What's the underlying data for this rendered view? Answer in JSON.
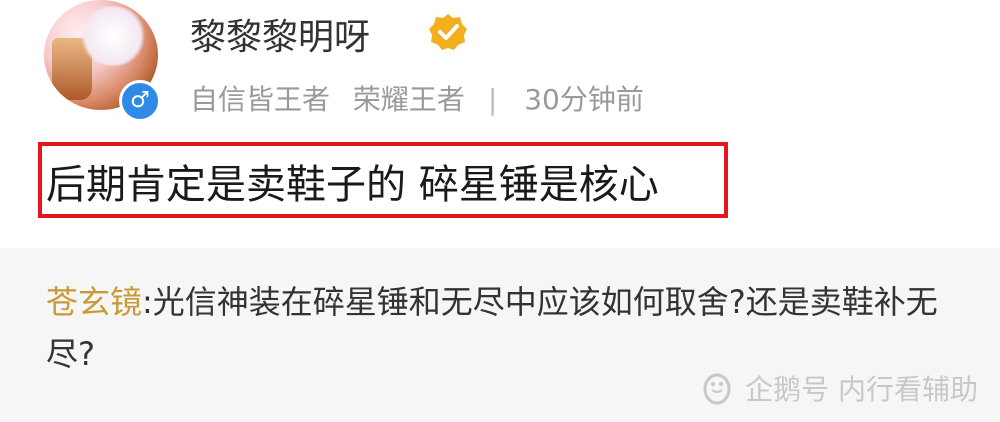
{
  "post": {
    "username": "黎黎黎明呀",
    "meta": {
      "title1": "自信皆王者",
      "title2": "荣耀王者",
      "separator": "|",
      "time": "30分钟前"
    },
    "gender_symbol": "♂",
    "comment": "后期肯定是卖鞋子的 碎星锤是核心"
  },
  "reply": {
    "author": "苍玄镜",
    "colon": ":",
    "text": "光信神装在碎星锤和无尽中应该如何取舍?还是卖鞋补无尽?"
  },
  "watermark": "企鹅号 内行看辅助",
  "colors": {
    "highlight_border": "#e3151e",
    "reply_author": "#c99a36",
    "badge": "#f2b01e",
    "gender": "#2e8ae6"
  }
}
